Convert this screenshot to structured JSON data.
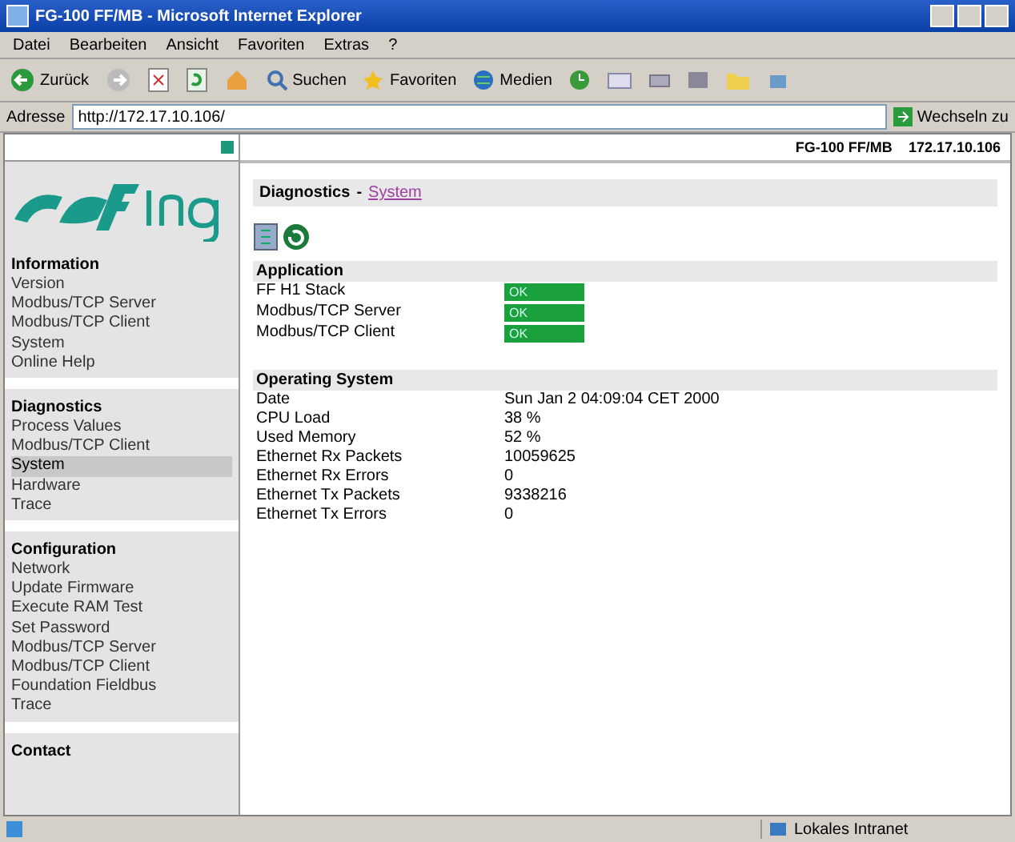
{
  "window": {
    "title": "FG-100 FF/MB - Microsoft Internet Explorer"
  },
  "menu": [
    "Datei",
    "Bearbeiten",
    "Ansicht",
    "Favoriten",
    "Extras",
    "?"
  ],
  "toolbar": {
    "back": "Zurück",
    "search": "Suchen",
    "favorites": "Favoriten",
    "media": "Medien"
  },
  "address_bar": {
    "label": "Adresse",
    "value": "http://172.17.10.106/",
    "go": "Wechseln zu"
  },
  "sidebar": {
    "sections": [
      {
        "title": "Information",
        "items": [
          {
            "label": "Version",
            "selected": false
          },
          {
            "label": "Modbus/TCP Server",
            "selected": false
          },
          {
            "label": "Modbus/TCP Client",
            "selected": false
          },
          {
            "label": "System",
            "selected": false
          },
          {
            "label": "Online Help",
            "selected": false
          }
        ]
      },
      {
        "title": "Diagnostics",
        "items": [
          {
            "label": "Process Values",
            "selected": false
          },
          {
            "label": "Modbus/TCP Client",
            "selected": false
          },
          {
            "label": "System",
            "selected": true
          },
          {
            "label": "Hardware",
            "selected": false
          },
          {
            "label": "Trace",
            "selected": false
          }
        ]
      },
      {
        "title": "Configuration",
        "items": [
          {
            "label": "Network",
            "selected": false
          },
          {
            "label": "Update Firmware",
            "selected": false
          },
          {
            "label": "Execute RAM Test",
            "selected": false
          },
          {
            "label": "Set Password",
            "selected": false
          },
          {
            "label": "Modbus/TCP Server",
            "selected": false
          },
          {
            "label": "Modbus/TCP Client",
            "selected": false
          },
          {
            "label": "Foundation Fieldbus",
            "selected": false
          },
          {
            "label": "Trace",
            "selected": false
          }
        ]
      },
      {
        "title": "Contact"
      }
    ]
  },
  "header": {
    "device": "FG-100 FF/MB",
    "ip": "172.17.10.106"
  },
  "breadcrumb": {
    "section": "Diagnostics",
    "separator": "-",
    "page": "System"
  },
  "application": {
    "title": "Application",
    "rows": [
      {
        "label": "FF H1 Stack",
        "status": "OK"
      },
      {
        "label": "Modbus/TCP Server",
        "status": "OK"
      },
      {
        "label": "Modbus/TCP Client",
        "status": "OK"
      }
    ]
  },
  "operating_system": {
    "title": "Operating System",
    "rows": [
      {
        "label": "Date",
        "value": "Sun Jan 2 04:09:04 CET 2000"
      },
      {
        "label": "CPU Load",
        "value": "38 %"
      },
      {
        "label": "Used Memory",
        "value": "52 %"
      },
      {
        "label": "Ethernet Rx Packets",
        "value": "10059625"
      },
      {
        "label": "Ethernet Rx Errors",
        "value": "0"
      },
      {
        "label": "Ethernet Tx Packets",
        "value": "9338216"
      },
      {
        "label": "Ethernet Tx Errors",
        "value": "0"
      }
    ]
  },
  "status_bar": {
    "zone": "Lokales Intranet"
  }
}
